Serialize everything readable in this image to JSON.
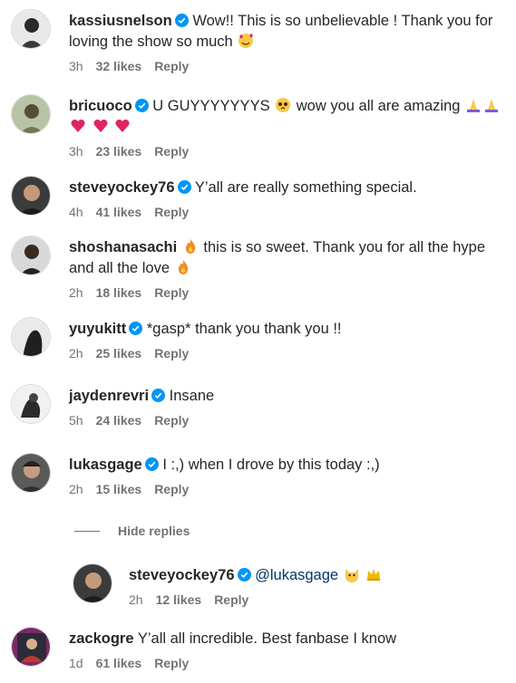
{
  "comments": [
    {
      "user": "kassiusnelson",
      "verified": true,
      "line1": "Wow!! This is so unbelievable ! Thank you for",
      "line2": "loving the show so much",
      "time": "3h",
      "likes": "32 likes",
      "reply": "Reply"
    },
    {
      "user": "bricuoco",
      "verified": true,
      "line1": "U GUYYYYYYYS",
      "line1b": "wow you all are amazing",
      "time": "3h",
      "likes": "23 likes",
      "reply": "Reply"
    },
    {
      "user": "steveyockey76",
      "verified": true,
      "line1": "Y’all are really something special.",
      "time": "4h",
      "likes": "41 likes",
      "reply": "Reply"
    },
    {
      "user": "shoshanasachi",
      "verified": false,
      "line1": "this is so sweet. Thank you for all the hype",
      "line2": "and all the love",
      "time": "2h",
      "likes": "18 likes",
      "reply": "Reply"
    },
    {
      "user": "yuyukitt",
      "verified": true,
      "line1": "*gasp* thank you thank you !!",
      "time": "2h",
      "likes": "25 likes",
      "reply": "Reply"
    },
    {
      "user": "jaydenrevri",
      "verified": true,
      "line1": "Insane",
      "time": "5h",
      "likes": "24 likes",
      "reply": "Reply"
    },
    {
      "user": "lukasgage",
      "verified": true,
      "line1": "I :,) when I drove by this today :,)",
      "time": "2h",
      "likes": "15 likes",
      "reply": "Reply"
    },
    {
      "user": "steveyockey76",
      "verified": true,
      "mention": "@lukasgage",
      "time": "2h",
      "likes": "12 likes",
      "reply": "Reply"
    },
    {
      "user": "zackogre",
      "verified": false,
      "line1": "Y’all all incredible. Best fanbase I know",
      "time": "1d",
      "likes": "61 likes",
      "reply": "Reply"
    }
  ],
  "hide_replies": "Hide replies",
  "colors": {
    "verified": "#0095f6",
    "heart": "#e0245e",
    "fire": "#f28c28",
    "folded": "#f7c948"
  }
}
